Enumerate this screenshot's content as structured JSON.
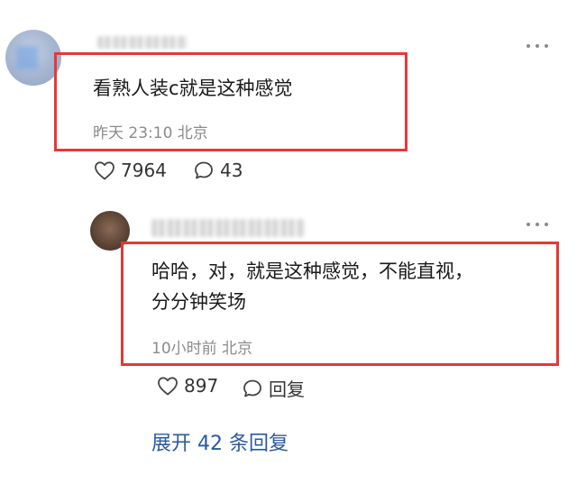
{
  "comment1": {
    "text": "看熟人装c就是这种感觉",
    "meta": "昨天 23:10 北京",
    "likes": "7964",
    "replies": "43"
  },
  "reply1": {
    "text_line1": "哈哈，对，就是这种感觉，不能直视，",
    "text_line2": "分分钟笑场",
    "meta": "10小时前 北京",
    "likes": "897",
    "reply_label": "回复"
  },
  "expand_label": "展开 42 条回复",
  "colors": {
    "highlight_box": "#e53935",
    "link": "#2b5a9b",
    "meta_text": "#8b8b8b"
  },
  "icons": [
    "heart-icon",
    "comment-icon",
    "more-icon"
  ]
}
